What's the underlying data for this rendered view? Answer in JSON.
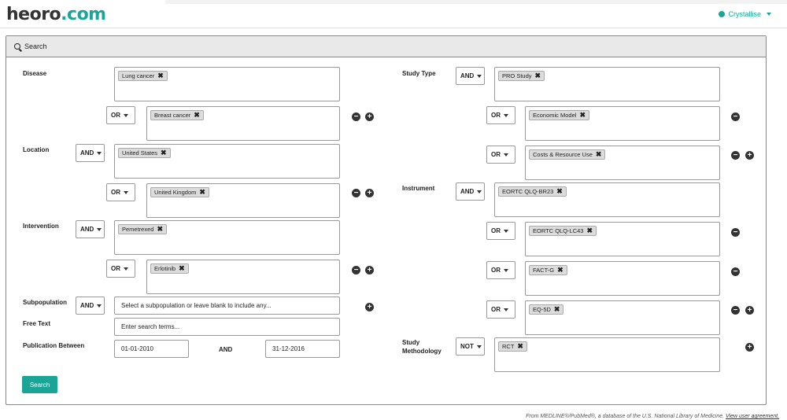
{
  "app": {
    "logo_part1": "heoro",
    "logo_part2": ".com",
    "user_name": "Crystallise",
    "accent_color": "#1aa597"
  },
  "panel": {
    "title": "Search",
    "search_icon": "search-icon",
    "submit_label": "Search"
  },
  "left": {
    "disease": {
      "label": "Disease",
      "tag": "Lung cancer",
      "row2_op": "OR",
      "row2_tag": "Breast cancer"
    },
    "location": {
      "label": "Location",
      "op": "AND",
      "tag": "United States",
      "row2_op": "OR",
      "row2_tag": "United Kingdom"
    },
    "intervention": {
      "label": "Intervention",
      "op": "AND",
      "tag": "Pemetrexed",
      "row2_op": "OR",
      "row2_tag": "Erlotinib"
    },
    "subpopulation": {
      "label": "Subpopulation",
      "op": "AND",
      "placeholder": "Select a subpopulation or leave blank to include any..."
    },
    "free_text": {
      "label": "Free Text",
      "placeholder": "Enter search terms..."
    },
    "publication": {
      "label": "Publication Between",
      "from": "01-01-2010",
      "and": "AND",
      "to": "31-12-2016"
    }
  },
  "right": {
    "study_type": {
      "label": "Study Type",
      "op": "AND",
      "tag": "PRO Study",
      "rows": [
        {
          "op": "OR",
          "tag": "Economic Model"
        },
        {
          "op": "OR",
          "tag": "Costs & Resource Use"
        }
      ]
    },
    "instrument": {
      "label": "Instrument",
      "op": "AND",
      "tag": "EORTC QLQ-BR23",
      "rows": [
        {
          "op": "OR",
          "tag": "EORTC QLQ-LC43"
        },
        {
          "op": "OR",
          "tag": "FACT-G"
        },
        {
          "op": "OR",
          "tag": "EQ-5D"
        }
      ]
    },
    "methodology": {
      "label_line1": "Study",
      "label_line2": "Methodology",
      "op": "NOT",
      "tag": "RCT"
    }
  },
  "footer": {
    "text": "From MEDLINE®/PubMed®, a database of the U.S. National Library of Medicine.",
    "link": "View user agreement."
  }
}
